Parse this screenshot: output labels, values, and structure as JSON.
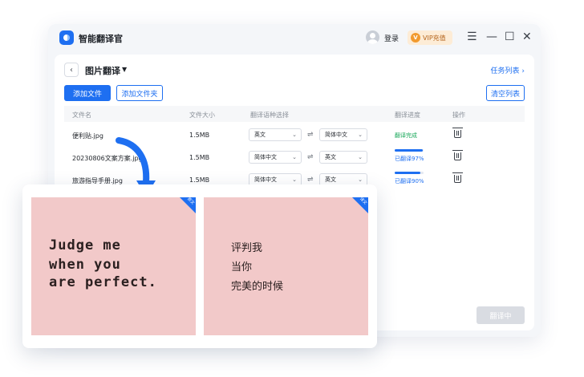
{
  "app": {
    "title": "智能翻译官",
    "login": "登录",
    "vip_label": "VIP充值",
    "vip_badge": "V"
  },
  "window_controls": {
    "menu": "☰",
    "minimize": "—",
    "maximize": "☐",
    "close": "✕"
  },
  "toolbar": {
    "back": "‹",
    "page_title": "图片翻译",
    "caret": "▼",
    "task_list": "任务列表 ›",
    "add_file": "添加文件",
    "add_folder": "添加文件夹",
    "clear_list": "清空列表",
    "translating": "翻译中"
  },
  "table": {
    "headers": [
      "文件名",
      "文件大小",
      "翻译语种选择",
      "翻译进度",
      "操作"
    ],
    "swap_glyph": "⇌",
    "rows": [
      {
        "name": "便利贴.jpg",
        "size": "1.5MB",
        "source_lang": "英文",
        "target_lang": "简体中文",
        "status": "翻译完成",
        "progress": null
      },
      {
        "name": "20230806文案方案.jpg",
        "size": "1.5MB",
        "source_lang": "简体中文",
        "target_lang": "英文",
        "status": "已翻译97%",
        "progress": 0.97
      },
      {
        "name": "旅游指导手册.jpg",
        "size": "1.5MB",
        "source_lang": "简体中文",
        "target_lang": "英文",
        "status": "已翻译90%",
        "progress": 0.9
      }
    ]
  },
  "compare": {
    "source_tag": "原文",
    "target_tag": "译文",
    "source_lines": [
      "Judge me",
      "when you",
      "are perfect."
    ],
    "target_lines": [
      "评判我",
      "当你",
      "完美的时候"
    ]
  },
  "colors": {
    "accent": "#1e6ff1",
    "success": "#1aa85b",
    "note_bg": "#f2c9c9",
    "vip_bg": "#fdecd6"
  }
}
